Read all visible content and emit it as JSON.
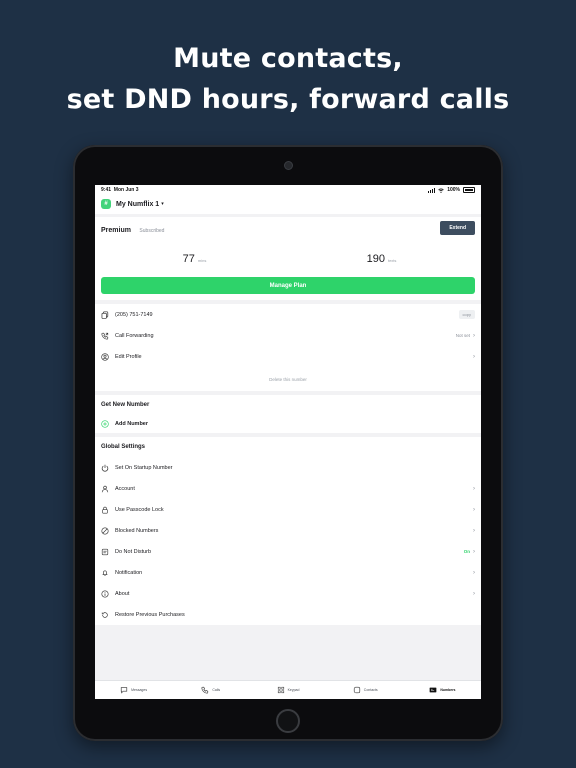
{
  "headline": {
    "line1": "Mute contacts,",
    "line2": "set DND hours, forward calls"
  },
  "status_bar": {
    "time": "9:41",
    "date": "Mon Jun 3",
    "battery": "100%"
  },
  "header": {
    "logo": "#",
    "number_name": "My Numflix 1"
  },
  "plan": {
    "name": "Premium",
    "status": "Subscribed",
    "extend_label": "Extend",
    "minutes_value": "77",
    "minutes_unit": "mins",
    "texts_value": "190",
    "texts_unit": "texts",
    "manage_label": "Manage Plan"
  },
  "number_rows": [
    {
      "icon": "copy-icon",
      "label": "(205) 751-7149",
      "action": "copy"
    },
    {
      "icon": "phone-forward-icon",
      "label": "Call Forwarding",
      "value": "Not set"
    },
    {
      "icon": "profile-icon",
      "label": "Edit Profile",
      "value": ""
    }
  ],
  "delete_label": "Delete this number",
  "new_number": {
    "title": "Get New Number",
    "add_label": "Add Number"
  },
  "global": {
    "title": "Global Settings",
    "items": [
      {
        "icon": "power-icon",
        "label": "Set On Startup Number",
        "value": "",
        "arrow": false
      },
      {
        "icon": "user-icon",
        "label": "Account",
        "value": "",
        "arrow": true
      },
      {
        "icon": "lock-icon",
        "label": "Use Passcode Lock",
        "value": "",
        "arrow": true
      },
      {
        "icon": "block-icon",
        "label": "Blocked Numbers",
        "value": "",
        "arrow": true
      },
      {
        "icon": "dnd-icon",
        "label": "Do Not Disturb",
        "value": "On",
        "arrow": true
      },
      {
        "icon": "bell-icon",
        "label": "Notification",
        "value": "",
        "arrow": true
      },
      {
        "icon": "info-icon",
        "label": "About",
        "value": "",
        "arrow": true
      },
      {
        "icon": "restore-icon",
        "label": "Restore Previous Purchases",
        "value": "",
        "arrow": false
      }
    ]
  },
  "tabs": [
    {
      "icon": "message-icon",
      "label": "Messages"
    },
    {
      "icon": "calls-icon",
      "label": "Calls"
    },
    {
      "icon": "keypad-icon",
      "label": "Keypad"
    },
    {
      "icon": "contacts-icon",
      "label": "Contacts"
    },
    {
      "icon": "numbers-icon",
      "label": "Numbers",
      "active": true
    }
  ],
  "colors": {
    "background": "#1e3045",
    "accent": "#2ed36a",
    "extend_button": "#3d4d5f"
  }
}
